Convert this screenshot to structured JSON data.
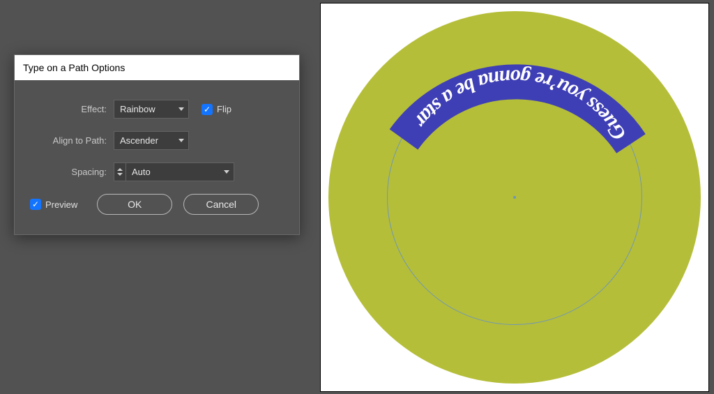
{
  "dialog": {
    "title": "Type on a Path Options",
    "effect_label": "Effect:",
    "effect_value": "Rainbow",
    "flip_label": "Flip",
    "flip_checked": true,
    "align_label": "Align to Path:",
    "align_value": "Ascender",
    "spacing_label": "Spacing:",
    "spacing_value": "Auto",
    "preview_label": "Preview",
    "preview_checked": true,
    "ok_label": "OK",
    "cancel_label": "Cancel"
  },
  "artwork": {
    "path_text": "Guess you’re gonna be a star",
    "colors": {
      "disc": "#b5be39",
      "highlight": "#3f3fb5",
      "text": "#ffffff",
      "guide": "#6f97b7",
      "background": "#ffffff"
    }
  }
}
